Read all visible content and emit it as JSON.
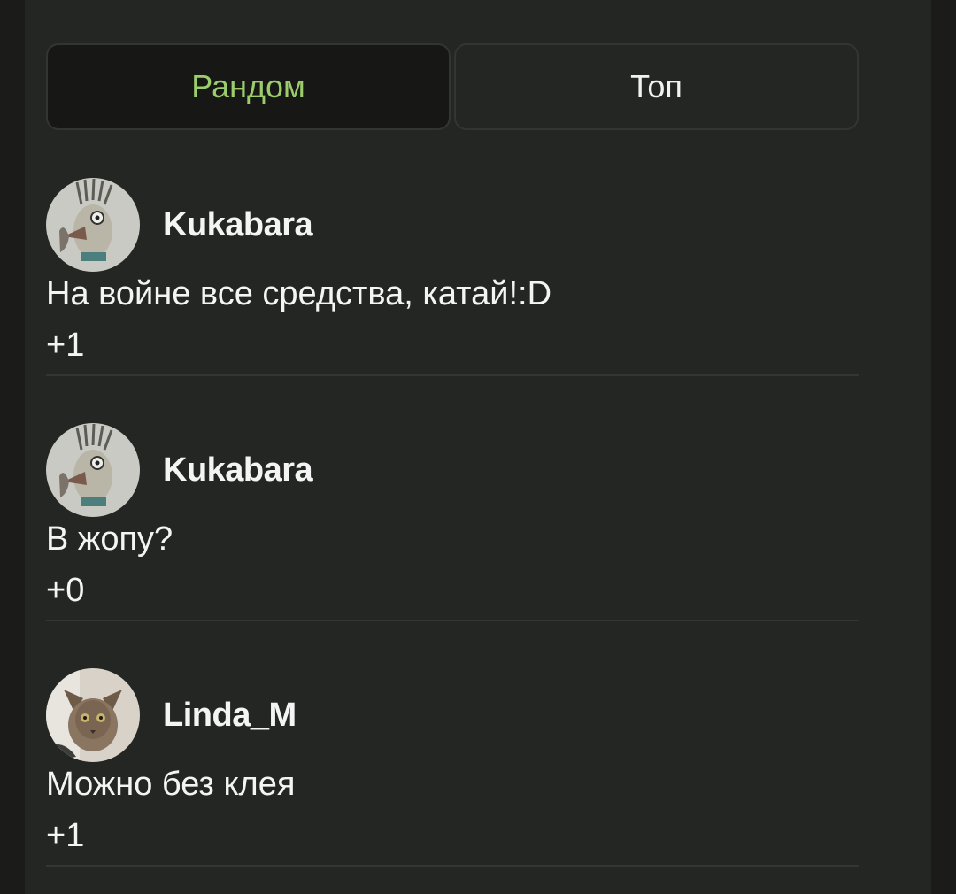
{
  "tabs": [
    {
      "label": "Рандом",
      "active": true
    },
    {
      "label": "Топ",
      "active": false
    }
  ],
  "comments": [
    {
      "username": "Kukabara",
      "text": "На войне все средства, катай!:D",
      "score": "+1",
      "avatar": "bird-avatar"
    },
    {
      "username": "Kukabara",
      "text": "В жопу?",
      "score": "+0",
      "avatar": "bird-avatar"
    },
    {
      "username": "Linda_M",
      "text": "Можно без клея",
      "score": "+1",
      "avatar": "cat-avatar"
    }
  ],
  "colors": {
    "background": "#1b1c1a",
    "panel": "#242623",
    "active_tab_bg": "#171816",
    "active_tab_text": "#9ccc6b",
    "text": "#f4f4f4",
    "divider": "#34372f"
  }
}
